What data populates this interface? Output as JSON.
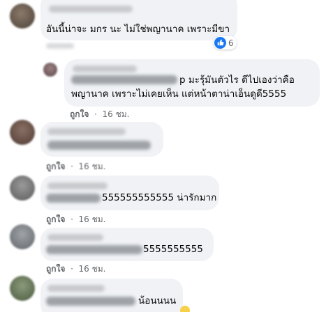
{
  "comments": [
    {
      "text": "อันนี้น่าจะ มกร นะ ไม่ใช่พญานาค เพราะมีขา",
      "reaction_count": "6"
    },
    {
      "text_line1": "p มะรุ้มันตัวไร ดีไปเองว่าคือ",
      "text_line2": "พญานาค เพราะไม่เคยเห็น แต่หน้าตาน่าเอ็นดูดี5555",
      "like": "ถูกใจ",
      "time": "16 ชม."
    },
    {
      "like": "ถูกใจ",
      "time": "16 ชม."
    },
    {
      "text": "555555555555 น่ารักมาก",
      "like": "ถูกใจ",
      "time": "16 ชม."
    },
    {
      "text": "5555555555",
      "like": "ถูกใจ",
      "time": "16 ชม."
    },
    {
      "text": "น้อนนนน"
    }
  ],
  "colors": {
    "bubble": "#f0f2f5",
    "meta": "#65676b",
    "like_blue": "#1877f2"
  },
  "icons": {
    "reaction": "like-thumb-icon"
  }
}
